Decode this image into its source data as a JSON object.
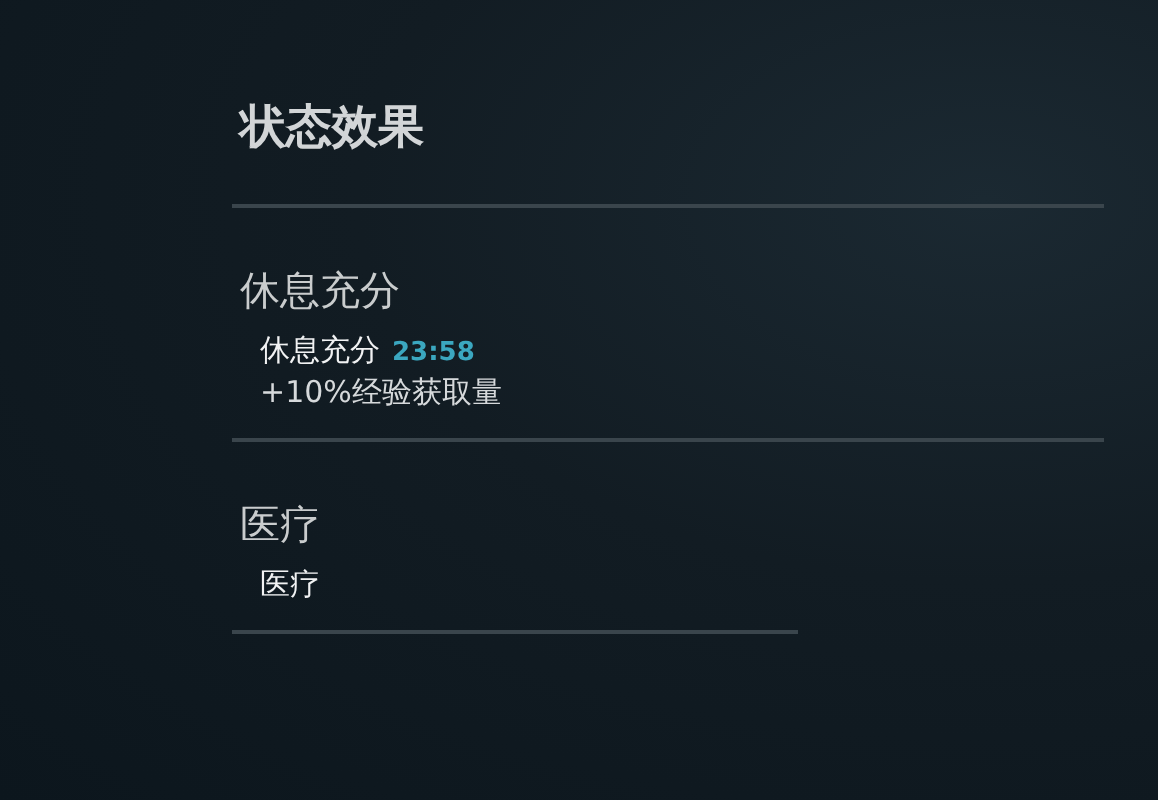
{
  "title": "状态效果",
  "sections": [
    {
      "heading": "休息充分",
      "effects": [
        {
          "name": "休息充分",
          "timer": "23:58",
          "description": "+10%经验获取量"
        }
      ]
    },
    {
      "heading": "医疗",
      "effects": [
        {
          "name": "医疗"
        }
      ]
    }
  ]
}
